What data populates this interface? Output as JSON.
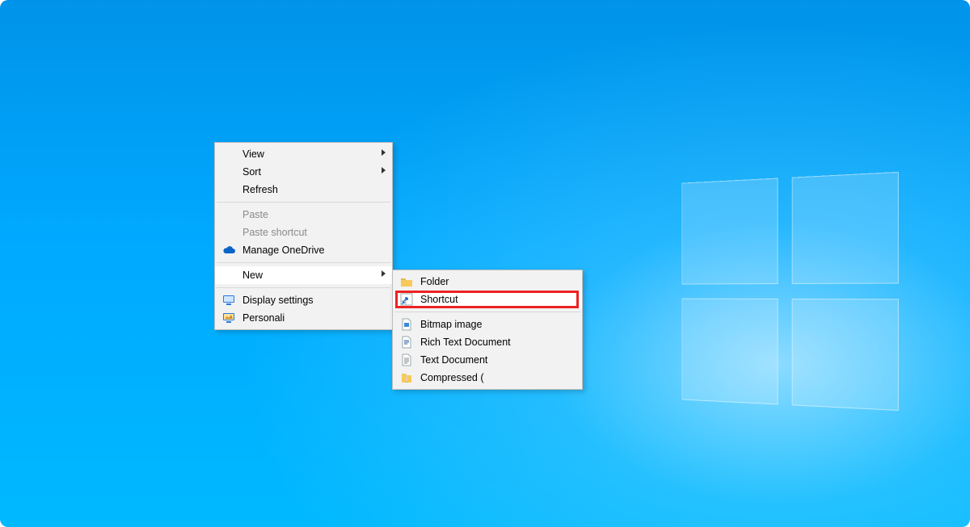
{
  "menu": {
    "view": "View",
    "sort": "Sort",
    "refresh": "Refresh",
    "paste": "Paste",
    "paste_shortcut": "Paste shortcut",
    "manage_onedrive": "Manage OneDrive",
    "new": "New",
    "display_settings": "Display settings",
    "personalize": "Personali"
  },
  "submenu": {
    "folder": "Folder",
    "shortcut": "Shortcut",
    "bitmap": "Bitmap image",
    "rtf": "Rich Text Document",
    "txt": "Text Document",
    "zip": "Compressed ("
  }
}
